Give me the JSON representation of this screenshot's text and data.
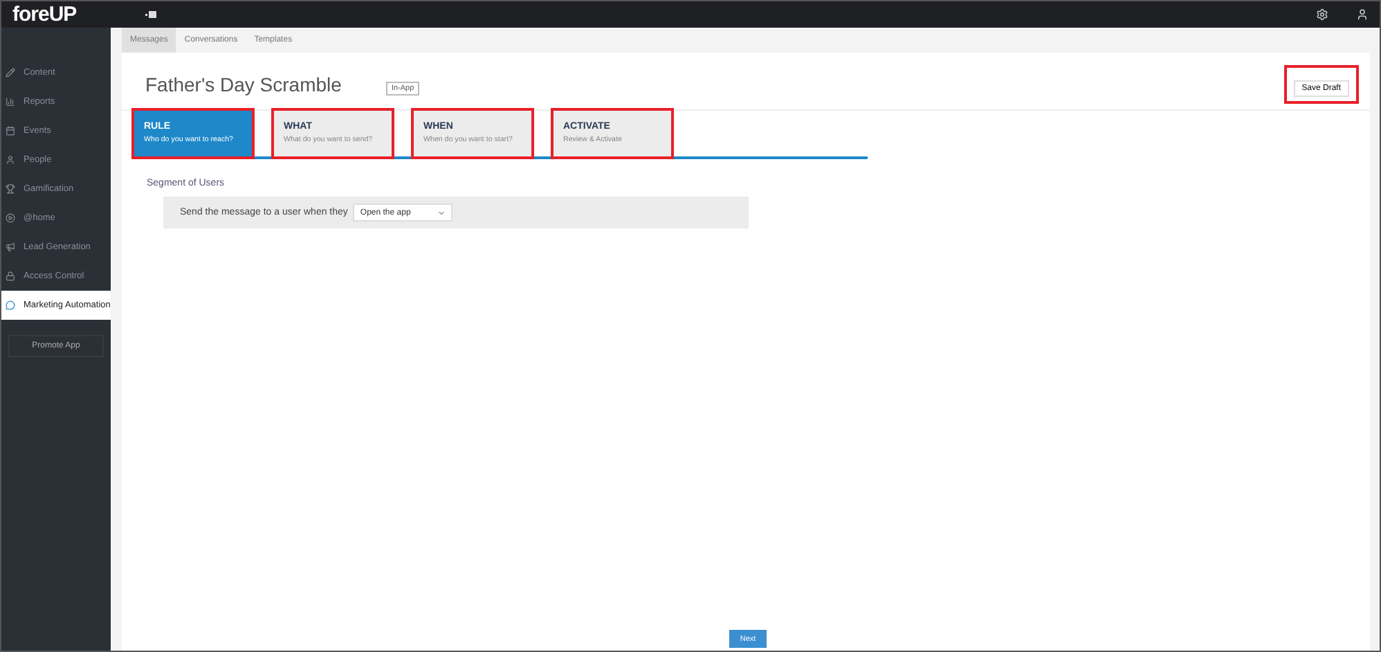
{
  "app": {
    "logo": "foreUP"
  },
  "sidebar": {
    "items": [
      {
        "label": "Content",
        "selected": false
      },
      {
        "label": "Reports",
        "selected": false
      },
      {
        "label": "Events",
        "selected": false
      },
      {
        "label": "People",
        "selected": false
      },
      {
        "label": "Gamification",
        "selected": false
      },
      {
        "label": "@home",
        "selected": false
      },
      {
        "label": "Lead Generation",
        "selected": false
      },
      {
        "label": "Access Control",
        "selected": false
      },
      {
        "label": "Marketing Automation",
        "selected": true
      }
    ],
    "promote_button": "Promote App"
  },
  "tabs": [
    {
      "label": "Messages",
      "selected": true
    },
    {
      "label": "Conversations",
      "selected": false
    },
    {
      "label": "Templates",
      "selected": false
    }
  ],
  "page": {
    "title": "Father's Day Scramble",
    "badge": "In-App",
    "save_button": {
      "label": "Save Draft",
      "highlighted": true
    }
  },
  "steps": [
    {
      "title": "RULE",
      "subtitle": "Who do you want to reach?",
      "selected": true,
      "highlighted": true
    },
    {
      "title": "WHAT",
      "subtitle": "What do you want to send?",
      "selected": false,
      "highlighted": true
    },
    {
      "title": "WHEN",
      "subtitle": "When do you want to start?",
      "selected": false,
      "highlighted": true
    },
    {
      "title": "ACTIVATE",
      "subtitle": "Review & Activate",
      "selected": false,
      "highlighted": true
    }
  ],
  "segment": {
    "heading": "Segment of Users",
    "label": "Send the message to a user when they",
    "select_value": "Open the app"
  },
  "next_button": "Next"
}
